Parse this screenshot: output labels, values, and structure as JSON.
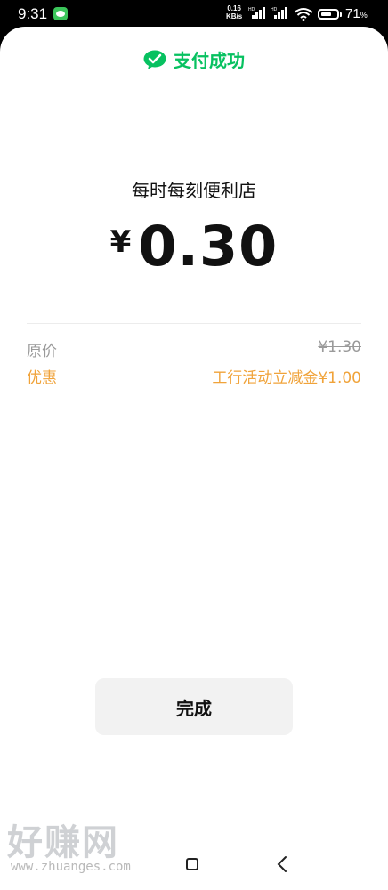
{
  "status_bar": {
    "time": "9:31",
    "net_speed_value": "0.16",
    "net_speed_unit": "KB/s",
    "battery_percent": "71",
    "battery_unit": "%",
    "battery_level": 0.71,
    "icons": [
      "wechat-notification-icon",
      "signal-hd-icon",
      "signal-hd-icon",
      "wifi-icon",
      "battery-icon"
    ]
  },
  "header": {
    "title": "支付成功",
    "icon": "wechat-pay-icon",
    "accent_color": "#07c160"
  },
  "payment": {
    "merchant": "每时每刻便利店",
    "currency_symbol": "¥",
    "amount": "0.30"
  },
  "details": {
    "original_label": "原价",
    "original_value": "¥1.30",
    "discount_label": "优惠",
    "discount_value": "工行活动立减金¥1.00",
    "discount_color": "#f0a33a"
  },
  "actions": {
    "done_label": "完成"
  },
  "watermark": {
    "title": "好赚网",
    "url": "www.zhuanges.com"
  },
  "nav": {
    "icons": [
      "home-square-icon",
      "back-chevron-icon"
    ]
  }
}
